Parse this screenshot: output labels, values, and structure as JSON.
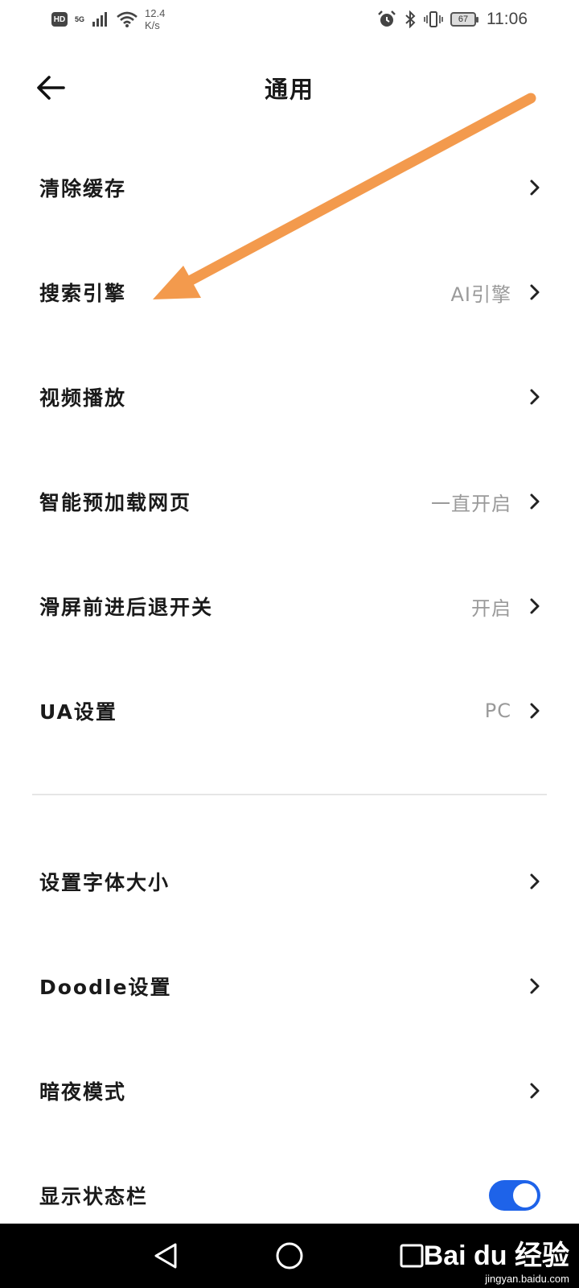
{
  "status_bar": {
    "hd": "HD",
    "network": "5G",
    "speed_value": "12.4",
    "speed_unit": "K/s",
    "battery": "67",
    "time": "11:06"
  },
  "header": {
    "title": "通用",
    "back_icon": "arrow-left-icon"
  },
  "settings": [
    {
      "label": "清除缓存",
      "value": ""
    },
    {
      "label": "搜索引擎",
      "value": "AI引擎"
    },
    {
      "label": "视频播放",
      "value": ""
    },
    {
      "label": "智能预加载网页",
      "value": "一直开启"
    },
    {
      "label": "滑屏前进后退开关",
      "value": "开启"
    },
    {
      "label": "UA设置",
      "value": "PC"
    }
  ],
  "settings2": [
    {
      "label": "设置字体大小"
    },
    {
      "label": "Doodle设置"
    },
    {
      "label": "暗夜模式"
    },
    {
      "label": "显示状态栏",
      "toggle": true
    }
  ],
  "colors": {
    "accent": "#1e63e9",
    "annotation_arrow": "#f39a4d"
  },
  "watermark": {
    "logo": "Bai du 经验",
    "url": "jingyan.baidu.com"
  }
}
